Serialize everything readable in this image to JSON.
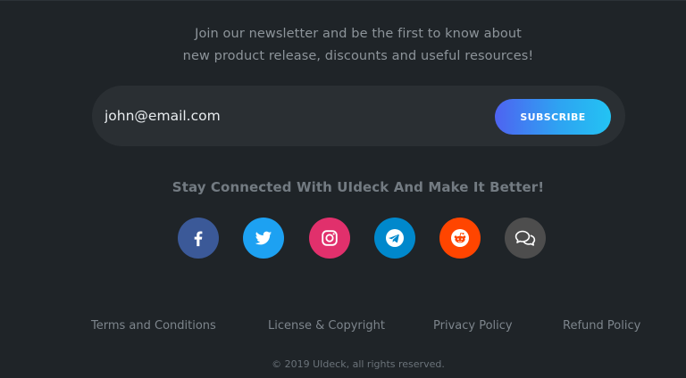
{
  "newsletter": {
    "intro_line1": "Join our newsletter and be the first to know about",
    "intro_line2": "new product release, discounts and useful resources!",
    "email_value": "john@email.com",
    "subscribe_label": "SUBSCRIBE"
  },
  "connect": {
    "title": "Stay Connected With UIdeck And Make It Better!",
    "social": [
      {
        "icon": "facebook-icon",
        "color": "#3b5998"
      },
      {
        "icon": "twitter-icon",
        "color": "#1da1f2"
      },
      {
        "icon": "instagram-icon",
        "color": "#e1306c"
      },
      {
        "icon": "telegram-icon",
        "color": "#0088cc"
      },
      {
        "icon": "reddit-icon",
        "color": "#ff4500"
      },
      {
        "icon": "chat-icon",
        "color": "#4d4d4d"
      }
    ]
  },
  "footer": {
    "links": [
      "Terms and Conditions",
      "License & Copyright",
      "Privacy Policy",
      "Refund Policy"
    ],
    "copyright": "© 2019 UIdeck, all rights reserved."
  },
  "colors": {
    "background": "#1f2428",
    "input_background": "#2a2f33",
    "button_gradient_start": "#4e63f1",
    "button_gradient_end": "#23c3f3"
  }
}
